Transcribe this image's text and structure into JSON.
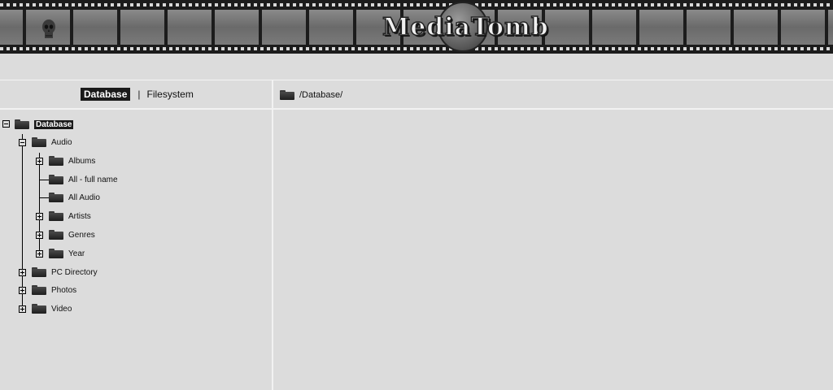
{
  "header": {
    "logo_text": "MediaTomb",
    "frame_count": 18
  },
  "left_pane": {
    "tabs": {
      "database": "Database",
      "separator": "|",
      "filesystem": "Filesystem"
    },
    "tree": {
      "root": "Database",
      "audio": "Audio",
      "albums": "Albums",
      "all_full_name": "All - full name",
      "all_audio": "All Audio",
      "artists": "Artists",
      "genres": "Genres",
      "year": "Year",
      "pc_directory": "PC Directory",
      "photos": "Photos",
      "video": "Video"
    }
  },
  "right_pane": {
    "path": "/Database/"
  },
  "icons": {
    "folder": "folder-icon",
    "expand": "plus-box-icon",
    "collapse": "minus-box-icon",
    "skull": "skull-icon"
  },
  "colors": {
    "background": "#dcdcdc",
    "selected_bg": "#1a1a1a",
    "film_dark": "#1c1c1c",
    "film_frame": "#7a7a7a"
  }
}
